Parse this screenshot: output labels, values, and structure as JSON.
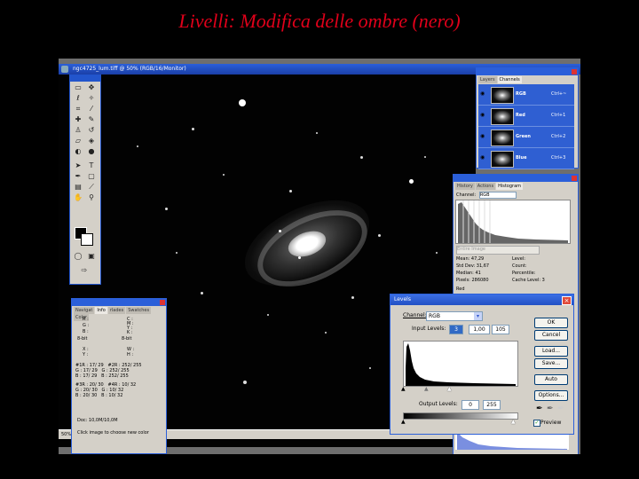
{
  "slide": {
    "title": "Livelli: Modifica delle ombre (nero)"
  },
  "document": {
    "title": "ngc4725_lum.tiff @ 50% (RGB/16/Monitor)",
    "zoom": "50%"
  },
  "info_panel": {
    "tabs": [
      "Navigat",
      "Info",
      "rlades",
      "Swatches",
      "Color"
    ],
    "active_tab": "Info",
    "rgb_labels": [
      "R :",
      "G :",
      "B :"
    ],
    "cmyk_labels": [
      "C :",
      "M :",
      "Y :",
      "K :"
    ],
    "depth_left": "8-bit",
    "depth_right": "8-bit",
    "xy_labels": [
      "X :",
      "Y :"
    ],
    "wh_labels": [
      "W :",
      "H :"
    ],
    "sample_rows": [
      {
        "l1": "#1R :",
        "v1": "17/ 29",
        "l2": "#2R :",
        "v2": "252/ 255"
      },
      {
        "l1": "G :",
        "v1": "17/ 29",
        "l2": "G :",
        "v2": "252/ 255"
      },
      {
        "l1": "B :",
        "v1": "17/ 29",
        "l2": "B :",
        "v2": "252/ 255"
      },
      {
        "l1": "#3R :",
        "v1": "20/ 30",
        "l2": "#4R :",
        "v2": "10/ 32"
      },
      {
        "l1": "G :",
        "v1": "20/ 30",
        "l2": "G :",
        "v2": "10/ 32"
      },
      {
        "l1": "B :",
        "v1": "20/ 30",
        "l2": "B :",
        "v2": "10/ 32"
      }
    ],
    "doc_size": "Doc: 10,0M/10,0M",
    "hint": "Click image to choose new color"
  },
  "channels_panel": {
    "tabs": [
      "Layers",
      "Channels"
    ],
    "active_tab": "Channels",
    "rows": [
      {
        "name": "RGB",
        "shortcut": "Ctrl+~"
      },
      {
        "name": "Red",
        "shortcut": "Ctrl+1"
      },
      {
        "name": "Green",
        "shortcut": "Ctrl+2"
      },
      {
        "name": "Blue",
        "shortcut": "Ctrl+3"
      }
    ]
  },
  "histogram_panel": {
    "tabs": [
      "History",
      "Actions",
      "Histogram"
    ],
    "active_tab": "Histogram",
    "channel_label": "Channel:",
    "channel_value": "RGB",
    "source_value": "Entire Image",
    "stats_left": [
      {
        "label": "Mean:",
        "value": "47,29"
      },
      {
        "label": "Std Dev:",
        "value": "31,67"
      },
      {
        "label": "Median:",
        "value": "41"
      },
      {
        "label": "Pixels:",
        "value": "286080"
      }
    ],
    "stats_right": [
      {
        "label": "Level:",
        "value": ""
      },
      {
        "label": "Count:",
        "value": ""
      },
      {
        "label": "Percentile:",
        "value": ""
      },
      {
        "label": "Cache Level:",
        "value": "3"
      }
    ],
    "bottom_label": "Red"
  },
  "levels_dialog": {
    "title": "Levels",
    "channel_label": "Channel:",
    "channel_value": "RGB",
    "input_label": "Input Levels:",
    "input_black": "3",
    "input_gamma": "1,00",
    "input_white": "105",
    "output_label": "Output Levels:",
    "output_black": "0",
    "output_white": "255",
    "buttons": [
      "OK",
      "Cancel",
      "Load...",
      "Save...",
      "Auto",
      "Options..."
    ],
    "preview_label": "Preview",
    "preview_checked": true
  }
}
